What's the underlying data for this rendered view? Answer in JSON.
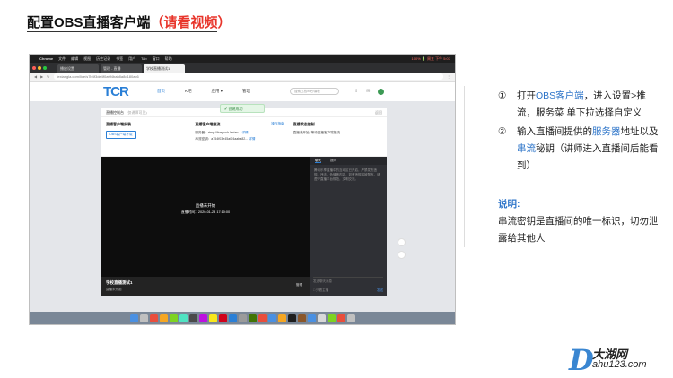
{
  "slide": {
    "title_main": "配置OBS直播客户端",
    "title_note": "（请看视频）"
  },
  "screenshot": {
    "menubar": {
      "app": "Chrome",
      "items": [
        "文件",
        "编辑",
        "视图",
        "历史记录",
        "书签",
        "用户",
        "Tab",
        "窗口",
        "帮助"
      ],
      "status": "100% 🔋 周五 下午 5:07"
    },
    "tabs": [
      {
        "label": "播放设置",
        "active": false
      },
      {
        "label": "管理 - 直播",
        "active": false
      },
      {
        "label": "学校直播测试1",
        "active": true
      }
    ],
    "address": "lexiangla.com/live/s7b4f3de4f0a0f4bab8a8d180ac6",
    "site": {
      "logo": "TCR",
      "nav": [
        "首页",
        "K吧",
        "应用 ▾",
        "管理"
      ],
      "active_nav": 0,
      "search_placeholder": "搜索文档/K吧/课程"
    },
    "toast": "✔ 创建成功",
    "panel": {
      "title": "直播控制台",
      "subtitle": "(仅讲师可见)",
      "back": "返回"
    },
    "config": {
      "client_title": "直播客户端安装",
      "client_button": "OBS客户端下载",
      "push_title": "直播客户端推流",
      "push_link": "操作指南",
      "server_label": "服务器：rtmp://livepush.lexian...",
      "server_action": "详情",
      "key_label": "串流密钥：a754f03e45a0f4aaba82...",
      "key_action": "详情",
      "status_title": "直播状态控制",
      "status_state": "直播未开始",
      "status_wait": "等待直播客户端推流"
    },
    "player": {
      "status": "直播未开始",
      "time": "直播时间：2020-01-28 17:10:00",
      "room_name": "学校直播测试1",
      "room_type": "直播未开始",
      "manage": "管理"
    },
    "chat": {
      "tabs": [
        "聊天",
        "提问"
      ],
      "message": "腾讯乐享直播中的互动区已开启，严禁发布违规、违法、色情等内容，如有违规将被禁言。请遵守直播平台规范，文明交流。",
      "input_placeholder": "发送聊天消息",
      "only_host": "□ 只看主播",
      "send": "发送"
    }
  },
  "instructions": {
    "steps": [
      {
        "num": "①",
        "pre": "打开",
        "highlight": "OBS客户端",
        "post": "，进入设置>推流，服务菜 单下拉选择自定义"
      },
      {
        "num": "②",
        "pre": "输入直播间提供的",
        "highlight": "服务器",
        "mid": "地址以及",
        "highlight2": "串流",
        "post": "秘钥（讲师进入直播间后能看到）"
      }
    ],
    "note_title": "说明:",
    "note_body": "串流密钥是直播间的唯一标识，切勿泄露给其他人"
  },
  "watermark": {
    "letter": "D",
    "name": "大湖网",
    "url": "ahu123.com"
  },
  "colors": {
    "accent_red": "#e8352b",
    "accent_blue": "#2e75c9",
    "link_blue": "#2a7fd6"
  }
}
